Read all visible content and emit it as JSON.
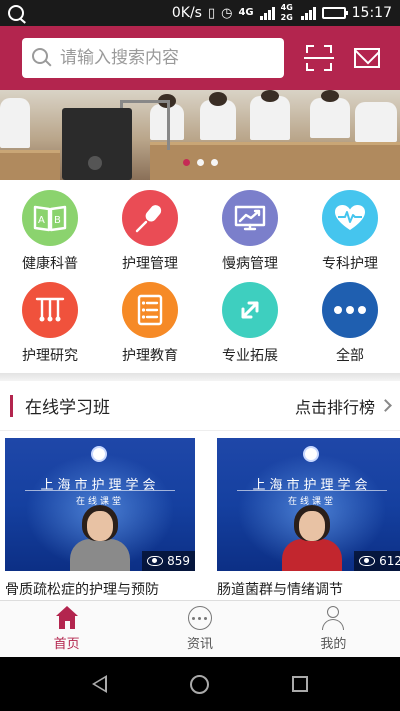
{
  "status_bar": {
    "speed": "0K/s",
    "network": "4G",
    "network_sub": "4G 2G",
    "time": "15:17",
    "battery_level": 0.85
  },
  "search": {
    "placeholder": "请输入搜索内容"
  },
  "banner": {
    "slide_count": 3,
    "active_slide": 1
  },
  "categories": [
    {
      "label": "健康科普",
      "icon": "book-ab-icon",
      "color": "#8bd36e"
    },
    {
      "label": "护理管理",
      "icon": "microphone-icon",
      "color": "#ea4c55"
    },
    {
      "label": "慢病管理",
      "icon": "trend-chart-icon",
      "color": "#7b7fcb"
    },
    {
      "label": "专科护理",
      "icon": "heart-pulse-icon",
      "color": "#45c5ee"
    },
    {
      "label": "护理研究",
      "icon": "test-tubes-icon",
      "color": "#f0523c"
    },
    {
      "label": "护理教育",
      "icon": "document-list-icon",
      "color": "#f68a26"
    },
    {
      "label": "专业拓展",
      "icon": "expand-arrows-icon",
      "color": "#3ecfbf"
    },
    {
      "label": "全部",
      "icon": "more-dots-icon",
      "color": "#1f5fb0"
    }
  ],
  "section": {
    "title": "在线学习班",
    "link": "点击排行榜"
  },
  "courses": [
    {
      "org": "上海市护理学会",
      "sub": "在线课堂",
      "views": "859",
      "title": "骨质疏松症的护理与预防",
      "outfit": "#8a8a8a"
    },
    {
      "org": "上海市护理学会",
      "sub": "在线课堂",
      "views": "612",
      "title": "肠道菌群与情绪调节",
      "outfit": "#c2262e"
    }
  ],
  "tabs": [
    {
      "label": "首页",
      "icon": "home-icon",
      "active": true
    },
    {
      "label": "资讯",
      "icon": "chat-bubble-icon",
      "active": false
    },
    {
      "label": "我的",
      "icon": "user-icon",
      "active": false
    }
  ]
}
